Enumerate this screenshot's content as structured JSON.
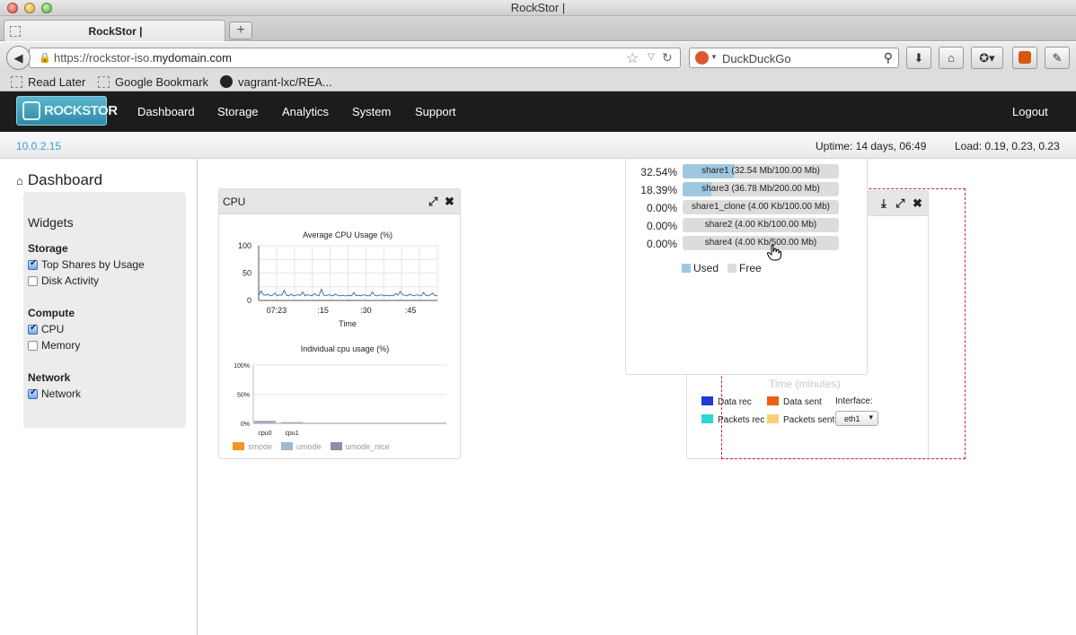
{
  "window": {
    "title": "RockStor |"
  },
  "tab": {
    "label": "RockStor |",
    "new_tab": "+"
  },
  "nav": {
    "url_prefix": "https://rockstor-iso.",
    "url_domain": "mydomain.com",
    "search_engine": "DuckDuckGo"
  },
  "bookmarks": [
    "Read Later",
    "Google Bookmark",
    "vagrant-lxc/REA..."
  ],
  "app": {
    "logo": "ROCKSTOR",
    "menu": [
      "Dashboard",
      "Storage",
      "Analytics",
      "System",
      "Support"
    ],
    "logout": "Logout",
    "ip": "10.0.2.15",
    "uptime": "Uptime: 14 days, 06:49",
    "load": "Load: 0.19, 0.23, 0.23"
  },
  "sidebar": {
    "title": "Dashboard",
    "widgets_title": "Widgets",
    "groups": [
      {
        "name": "Storage",
        "items": [
          {
            "label": "Top Shares by Usage",
            "checked": true
          },
          {
            "label": "Disk Activity",
            "checked": false
          }
        ]
      },
      {
        "name": "Compute",
        "items": [
          {
            "label": "CPU",
            "checked": true
          },
          {
            "label": "Memory",
            "checked": false
          }
        ]
      },
      {
        "name": "Network",
        "items": [
          {
            "label": "Network",
            "checked": true
          }
        ]
      }
    ]
  },
  "cpu_widget": {
    "title": "CPU",
    "avg_chart_title": "Average CPU Usage (%)",
    "avg_xlabel": "Time",
    "avg_yticks": [
      "100",
      "50",
      "0"
    ],
    "avg_xticks": [
      "07:23",
      ":15",
      ":30",
      ":45"
    ],
    "ind_chart_title": "Individual cpu usage (%)",
    "ind_yticks": [
      "100%",
      "50%",
      "0%"
    ],
    "ind_categories": [
      "cpu0",
      "cpu1"
    ],
    "legend": [
      {
        "name": "smode",
        "color": "#f39425"
      },
      {
        "name": "umode",
        "color": "#9fb8d4"
      },
      {
        "name": "umode_nice",
        "color": "#8c8cab"
      }
    ]
  },
  "shares_widget": {
    "legend_used": "Used",
    "legend_free": "Free",
    "rows": [
      {
        "pct": "32.54%",
        "label": "share1 (32.54 Mb/100.00 Mb)",
        "used": 0.3254
      },
      {
        "pct": "18.39%",
        "label": "share3 (36.78 Mb/200.00 Mb)",
        "used": 0.1839
      },
      {
        "pct": "0.00%",
        "label": "share1_clone (4.00 Kb/100.00 Mb)",
        "used": 0
      },
      {
        "pct": "0.00%",
        "label": "share2 (4.00 Kb/100.00 Mb)",
        "used": 0
      },
      {
        "pct": "0.00%",
        "label": "share4 (4.00 Kb/500.00 Mb)",
        "used": 0
      }
    ]
  },
  "network_widget": {
    "axis_label": "Time (minutes)",
    "legend": [
      {
        "name": "Data rec",
        "color": "#1f3ad6"
      },
      {
        "name": "Data sent",
        "color": "#ea6010"
      },
      {
        "name": "Packets rec",
        "color": "#2fd4d4"
      },
      {
        "name": "Packets sent",
        "color": "#f6cf78"
      }
    ],
    "interface_label": "Interface:",
    "interface_value": "eth1"
  },
  "chart_data": [
    {
      "type": "line",
      "title": "Average CPU Usage (%)",
      "xlabel": "Time",
      "ylabel": "",
      "ylim": [
        0,
        100
      ],
      "x_ticks": [
        "07:23",
        ":15",
        ":30",
        ":45"
      ],
      "series": [
        {
          "name": "",
          "values": [
            2,
            11,
            4,
            3,
            5,
            2,
            3,
            7,
            2,
            4,
            3,
            12,
            3,
            2,
            5,
            2,
            3,
            4,
            3,
            9,
            2,
            4,
            3,
            2,
            6,
            3,
            2,
            14,
            3,
            2,
            4,
            3,
            2,
            5,
            3,
            2,
            3,
            2,
            2,
            3,
            2,
            8,
            2,
            3,
            2,
            4,
            3,
            2,
            2,
            9,
            3,
            2,
            3,
            4,
            2,
            3,
            2,
            3,
            2,
            6,
            3,
            10,
            4,
            3,
            2,
            5,
            3,
            2,
            4,
            3,
            2,
            8,
            3,
            2,
            4,
            7,
            2,
            3
          ]
        }
      ],
      "grid": true
    },
    {
      "type": "bar",
      "title": "Individual cpu usage (%)",
      "categories": [
        "cpu0",
        "cpu1"
      ],
      "ylim": [
        0,
        100
      ],
      "series": [
        {
          "name": "smode",
          "values": [
            0,
            0
          ]
        },
        {
          "name": "umode",
          "values": [
            2,
            1
          ]
        },
        {
          "name": "umode_nice",
          "values": [
            2,
            1
          ]
        }
      ],
      "grid": true
    }
  ]
}
